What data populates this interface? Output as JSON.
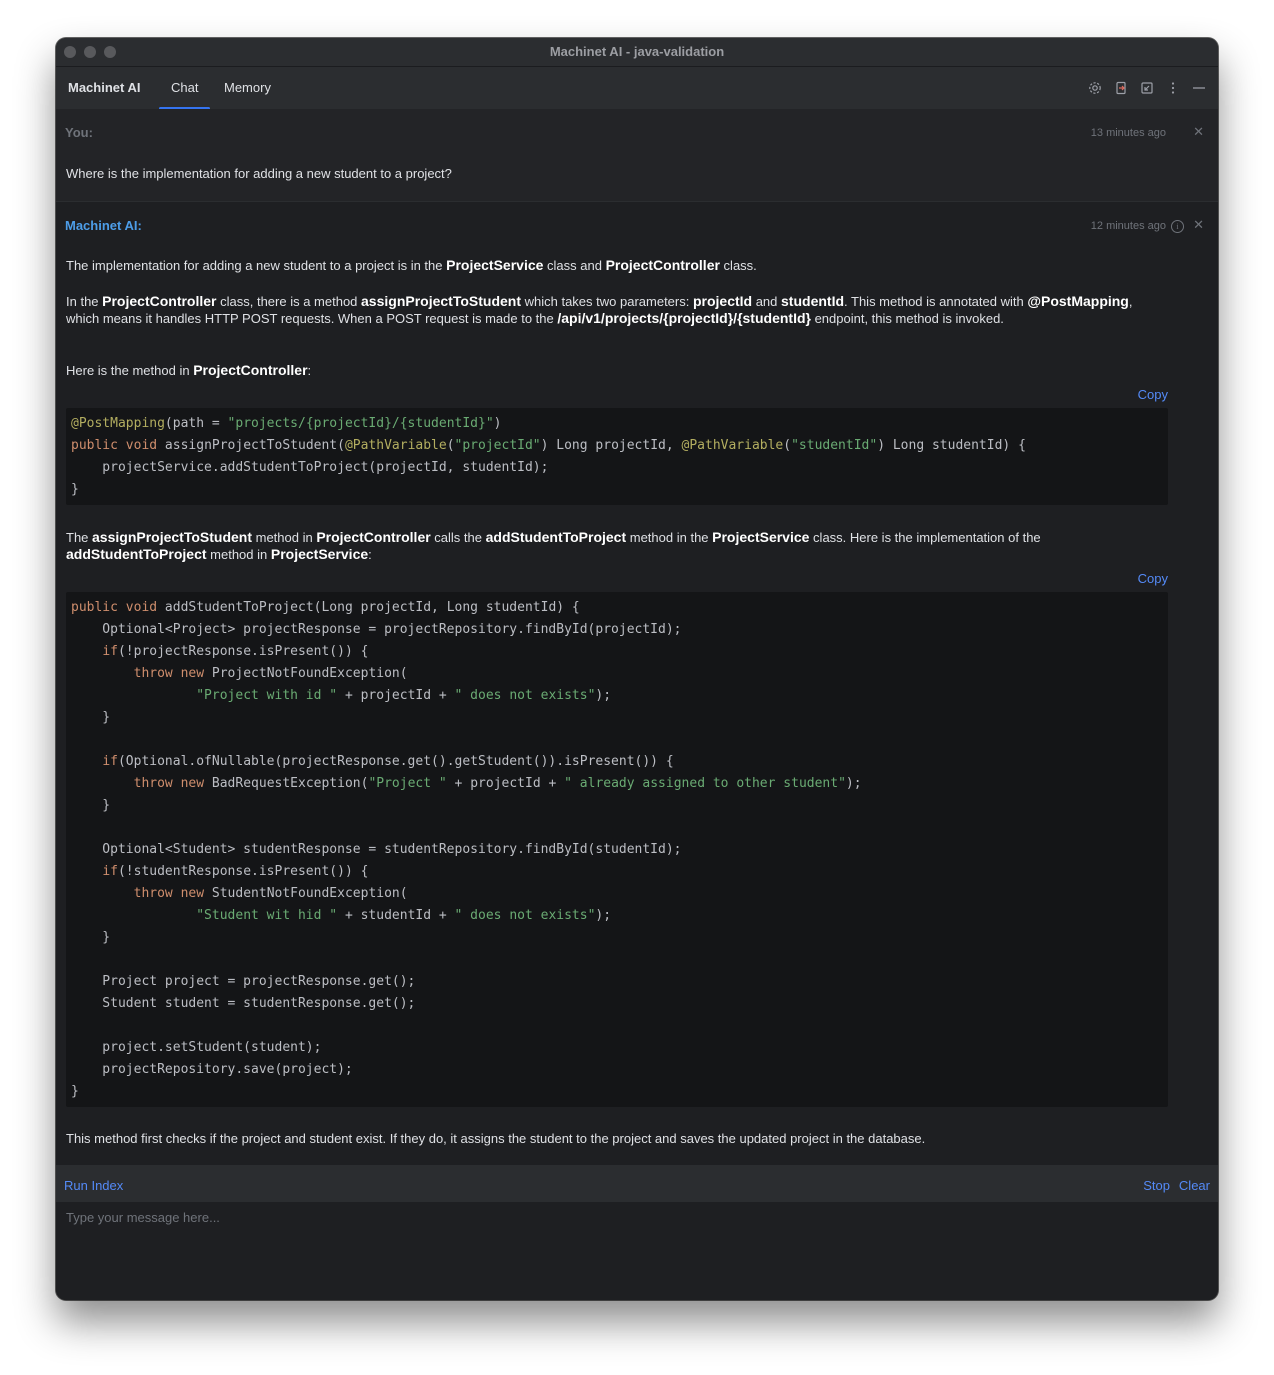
{
  "window": {
    "title": "Machinet AI - java-validation"
  },
  "toolbar": {
    "brand": "Machinet AI",
    "tabs": [
      {
        "label": "Chat",
        "active": true
      },
      {
        "label": "Memory",
        "active": false
      }
    ],
    "icons": [
      "gear-icon",
      "export-icon",
      "import-icon",
      "more-icon",
      "minimize-icon"
    ]
  },
  "user_message": {
    "author": "You:",
    "time": "13 minutes ago",
    "text": "Where is the implementation for adding a new student to a project?"
  },
  "ai_message": {
    "author": "Machinet AI:",
    "time": "12 minutes ago",
    "copy_label_1": "Copy",
    "copy_label_2": "Copy",
    "para1": "The implementation for adding a new student to a project is in the ProjectService class and ProjectController class.",
    "para2": "In the ProjectController class, there is a method assignProjectToStudent which takes two parameters: projectId and studentId. This method is annotated with @PostMapping, which means it handles HTTP POST requests. When a POST request is made to the /api/v1/projects/{projectId}/{studentId} endpoint, this method is invoked.",
    "para3": "Here is the method in ProjectController:",
    "para4": "The assignProjectToStudent method in ProjectController calls the addStudentToProject method in the ProjectService class. Here is the implementation of the addStudentToProject method in ProjectService:",
    "para5": "This method first checks if the project and student exist. If they do, it assigns the student to the project and saves the updated project in the database.",
    "code1": [
      "@PostMapping(path = \"projects/{projectId}/{studentId}\")",
      "public void assignProjectToStudent(@PathVariable(\"projectId\") Long projectId, @PathVariable(\"studentId\") Long studentId) {",
      "    projectService.addStudentToProject(projectId, studentId);",
      "}"
    ],
    "code2": [
      "public void addStudentToProject(Long projectId, Long studentId) {",
      "    Optional<Project> projectResponse = projectRepository.findById(projectId);",
      "    if(!projectResponse.isPresent()) {",
      "        throw new ProjectNotFoundException(",
      "                \"Project with id \" + projectId + \" does not exists\");",
      "    }",
      "",
      "    if(Optional.ofNullable(projectResponse.get().getStudent()).isPresent()) {",
      "        throw new BadRequestException(\"Project \" + projectId + \" already assigned to other student\");",
      "    }",
      "",
      "    Optional<Student> studentResponse = studentRepository.findById(studentId);",
      "    if(!studentResponse.isPresent()) {",
      "        throw new StudentNotFoundException(",
      "                \"Student wit hid \" + studentId + \" does not exists\");",
      "    }",
      "",
      "    Project project = projectResponse.get();",
      "    Student student = studentResponse.get();",
      "",
      "    project.setStudent(student);",
      "    projectRepository.save(project);",
      "}"
    ]
  },
  "bottom": {
    "run_index": "Run Index",
    "stop": "Stop",
    "clear": "Clear",
    "input_placeholder": "Type your message here..."
  }
}
